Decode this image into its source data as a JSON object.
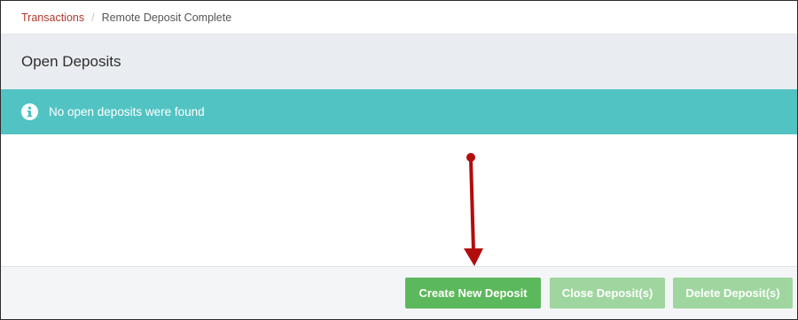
{
  "breadcrumb": {
    "link_label": "Transactions",
    "separator": "/",
    "current": "Remote Deposit Complete"
  },
  "panel": {
    "title": "Open Deposits"
  },
  "alert": {
    "message": "No open deposits were found",
    "color": "#52c3c3",
    "icon": "info-circle-icon"
  },
  "actions": {
    "create_label": "Create New Deposit",
    "close_label": "Close Deposit(s)",
    "delete_label": "Delete Deposit(s)",
    "primary_color": "#5cb85c",
    "disabled_color": "#9fd69f"
  },
  "annotation": {
    "arrow_color": "#b20d0d"
  }
}
